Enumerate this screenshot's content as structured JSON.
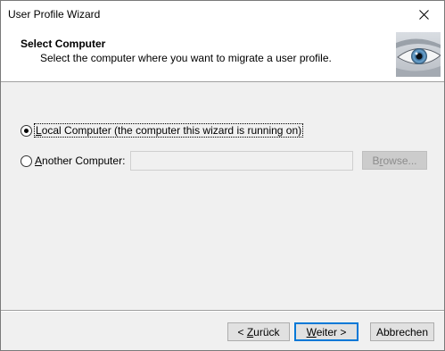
{
  "window": {
    "title": "User Profile Wizard",
    "close_icon": "close-icon"
  },
  "header": {
    "title": "Select Computer",
    "subtitle": "Select the computer where you want to migrate a user profile.",
    "image_icon": "eye-image"
  },
  "options": {
    "local_computer": {
      "label_accel": "L",
      "label_rest": "ocal Computer (the computer this wizard is running on)",
      "checked": true
    },
    "another_computer": {
      "label_accel": "A",
      "label_rest": "nother Computer:",
      "checked": false,
      "input_value": ""
    },
    "browse_label": "Browse...",
    "browse_accel": "r"
  },
  "buttons": {
    "back_label_prefix": "< ",
    "back_accel": "Z",
    "back_rest": "urück",
    "next_accel": "W",
    "next_rest": "eiter >",
    "cancel_label": "Abbrechen"
  }
}
